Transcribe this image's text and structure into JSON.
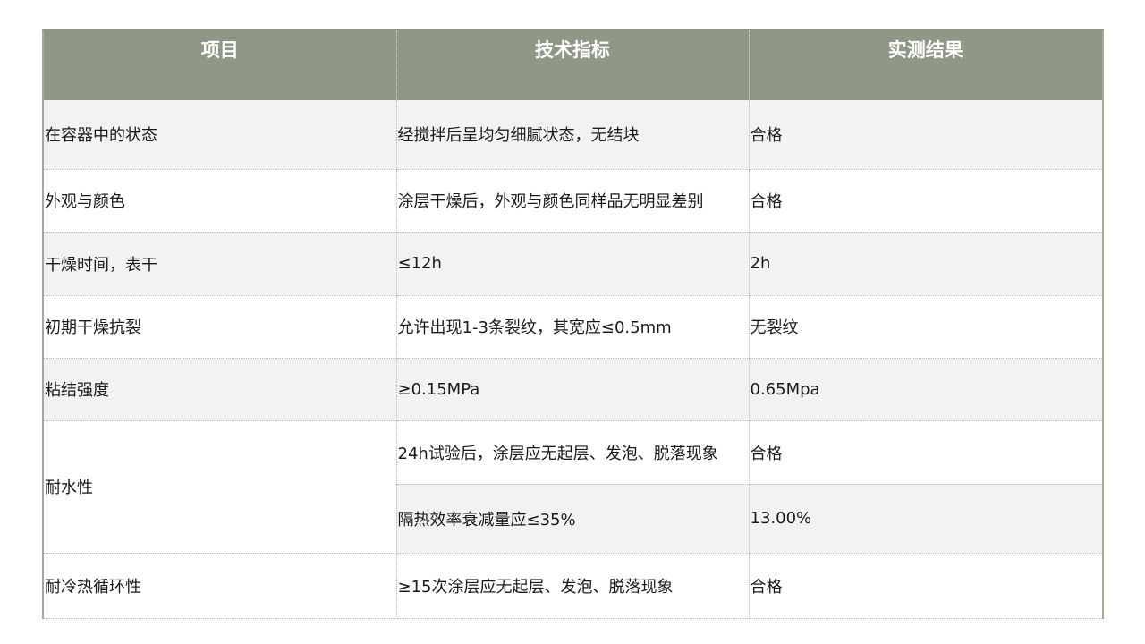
{
  "table": {
    "headers": [
      "项目",
      "技术指标",
      "实测结果"
    ],
    "rows": [
      {
        "item": "在容器中的状态",
        "spec": "经搅拌后呈均匀细腻状态，无结块",
        "result": "合格"
      },
      {
        "item": "外观与颜色",
        "spec": "涂层干燥后，外观与颜色同样品无明显差别",
        "result": "合格"
      },
      {
        "item": "干燥时间，表干",
        "spec": "≤12h",
        "result": "2h"
      },
      {
        "item": "初期干燥抗裂",
        "spec": "允许出现1-3条裂纹，其宽应≤0.5mm",
        "result": "无裂纹"
      },
      {
        "item": "粘结强度",
        "spec": "≥0.15MPa",
        "result": "0.65Mpa"
      },
      {
        "item": "耐水性",
        "sub": [
          {
            "spec": "24h试验后，涂层应无起层、发泡、脱落现象",
            "result": "合格"
          },
          {
            "spec": "隔热效率衰减量应≤35%",
            "result": "13.00%"
          }
        ]
      },
      {
        "item": "耐冷热循环性",
        "spec": "≥15次涂层应无起层、发泡、脱落现象",
        "result": "合格"
      }
    ]
  }
}
